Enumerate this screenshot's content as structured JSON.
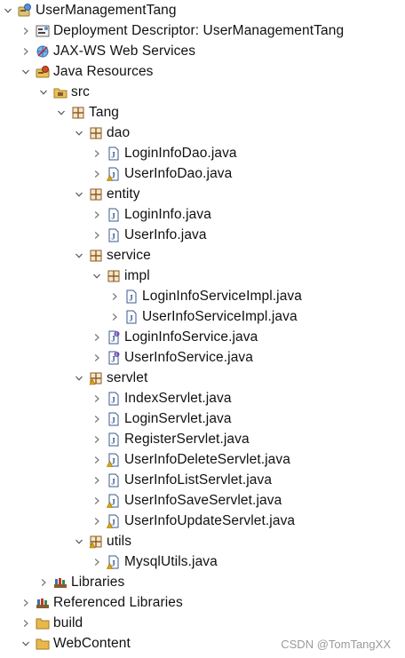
{
  "tree": [
    {
      "label": "UserManagementTang",
      "icon": "project-icon",
      "arrow": "expanded",
      "level": 0
    },
    {
      "label": "Deployment Descriptor: UserManagementTang",
      "icon": "deployment-descriptor-icon",
      "arrow": "collapsed",
      "level": 1
    },
    {
      "label": "JAX-WS Web Services",
      "icon": "web-services-icon",
      "arrow": "collapsed",
      "level": 1
    },
    {
      "label": "Java Resources",
      "icon": "java-resources-icon",
      "arrow": "expanded",
      "level": 1
    },
    {
      "label": "src",
      "icon": "source-folder-icon",
      "arrow": "expanded",
      "level": 2
    },
    {
      "label": "Tang",
      "icon": "package-icon",
      "arrow": "expanded",
      "level": 3
    },
    {
      "label": "dao",
      "icon": "package-icon",
      "arrow": "expanded",
      "level": 4
    },
    {
      "label": "LoginInfoDao.java",
      "icon": "java-file-icon",
      "arrow": "collapsed",
      "level": 5
    },
    {
      "label": "UserInfoDao.java",
      "icon": "java-file-warning-icon",
      "arrow": "collapsed",
      "level": 5
    },
    {
      "label": "entity",
      "icon": "package-icon",
      "arrow": "expanded",
      "level": 4
    },
    {
      "label": "LoginInfo.java",
      "icon": "java-file-icon",
      "arrow": "collapsed",
      "level": 5
    },
    {
      "label": "UserInfo.java",
      "icon": "java-file-icon",
      "arrow": "collapsed",
      "level": 5
    },
    {
      "label": "service",
      "icon": "package-icon",
      "arrow": "expanded",
      "level": 4
    },
    {
      "label": "impl",
      "icon": "package-icon",
      "arrow": "expanded",
      "level": 5
    },
    {
      "label": "LoginInfoServiceImpl.java",
      "icon": "java-file-icon",
      "arrow": "collapsed",
      "level": 6
    },
    {
      "label": "UserInfoServiceImpl.java",
      "icon": "java-file-icon",
      "arrow": "collapsed",
      "level": 6
    },
    {
      "label": "LoginInfoService.java",
      "icon": "java-interface-file-icon",
      "arrow": "collapsed",
      "level": 5
    },
    {
      "label": "UserInfoService.java",
      "icon": "java-interface-file-icon",
      "arrow": "collapsed",
      "level": 5
    },
    {
      "label": "servlet",
      "icon": "package-warning-icon",
      "arrow": "expanded",
      "level": 4
    },
    {
      "label": "IndexServlet.java",
      "icon": "java-file-icon",
      "arrow": "collapsed",
      "level": 5
    },
    {
      "label": "LoginServlet.java",
      "icon": "java-file-icon",
      "arrow": "collapsed",
      "level": 5
    },
    {
      "label": "RegisterServlet.java",
      "icon": "java-file-icon",
      "arrow": "collapsed",
      "level": 5
    },
    {
      "label": "UserInfoDeleteServlet.java",
      "icon": "java-file-warning-icon",
      "arrow": "collapsed",
      "level": 5
    },
    {
      "label": "UserInfoListServlet.java",
      "icon": "java-file-icon",
      "arrow": "collapsed",
      "level": 5
    },
    {
      "label": "UserInfoSaveServlet.java",
      "icon": "java-file-warning-icon",
      "arrow": "collapsed",
      "level": 5
    },
    {
      "label": "UserInfoUpdateServlet.java",
      "icon": "java-file-warning-icon",
      "arrow": "collapsed",
      "level": 5
    },
    {
      "label": "utils",
      "icon": "package-warning-icon",
      "arrow": "expanded",
      "level": 4
    },
    {
      "label": "MysqlUtils.java",
      "icon": "java-file-warning-icon",
      "arrow": "collapsed",
      "level": 5
    },
    {
      "label": "Libraries",
      "icon": "libraries-icon",
      "arrow": "collapsed",
      "level": 2
    },
    {
      "label": "Referenced Libraries",
      "icon": "libraries-icon",
      "arrow": "collapsed",
      "level": 1
    },
    {
      "label": "build",
      "icon": "folder-icon",
      "arrow": "collapsed",
      "level": 1
    },
    {
      "label": "WebContent",
      "icon": "folder-icon",
      "arrow": "expanded",
      "level": 1
    }
  ],
  "watermark": "CSDN @TomTangXX",
  "colors": {
    "package": "#8b5a2b",
    "java_file": "#3a5a8c",
    "warning": "#e0a800",
    "folder": "#e8b84a",
    "interface_mark": "#6a4fb3"
  }
}
